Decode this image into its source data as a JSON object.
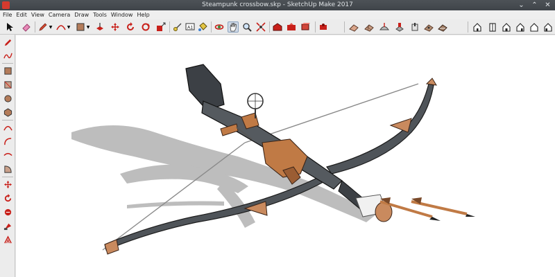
{
  "window": {
    "title": "Steampunk crossbow.skp - SketchUp Make 2017",
    "controls": [
      "⌄",
      "⌃",
      "✕"
    ]
  },
  "menubar": {
    "items": [
      "File",
      "Edit",
      "View",
      "Camera",
      "Draw",
      "Tools",
      "Window",
      "Help"
    ]
  },
  "toolbar": {
    "tools": [
      {
        "name": "select-tool",
        "icon": "arrow-icon"
      },
      {
        "name": "eraser-tool",
        "icon": "eraser-icon"
      },
      {
        "name": "line-tool",
        "icon": "pencil-icon"
      },
      {
        "name": "arc-tool",
        "icon": "arc-icon"
      },
      {
        "name": "shape-tool",
        "icon": "rectangle-icon"
      },
      {
        "name": "push-pull-tool",
        "icon": "push-pull-icon"
      },
      {
        "name": "move-tool",
        "icon": "move-icon"
      },
      {
        "name": "rotate-tool",
        "icon": "rotate-icon"
      },
      {
        "name": "scale-tool",
        "icon": "scale-icon"
      },
      {
        "name": "tape-measure-tool",
        "icon": "tape-measure-icon"
      },
      {
        "name": "text-tool",
        "icon": "text-icon",
        "label": "A1"
      },
      {
        "name": "paint-bucket-tool",
        "icon": "paint-bucket-icon"
      },
      {
        "name": "orbit-tool",
        "icon": "orbit-icon"
      },
      {
        "name": "pan-tool",
        "icon": "hand-icon",
        "active": true
      },
      {
        "name": "zoom-tool",
        "icon": "magnifier-icon"
      },
      {
        "name": "zoom-extents-tool",
        "icon": "zoom-extents-icon"
      },
      {
        "name": "warehouse-tool",
        "icon": "warehouse-icon"
      },
      {
        "name": "share-model-tool",
        "icon": "share-icon"
      },
      {
        "name": "components-tool",
        "icon": "components-icon"
      },
      {
        "name": "extension-tool",
        "icon": "extension-icon"
      },
      {
        "name": "sandbox-contours-tool",
        "icon": "sandbox-icon"
      },
      {
        "name": "sandbox-scratch-tool",
        "icon": "sandbox-grid-icon"
      },
      {
        "name": "sandbox-smoove-tool",
        "icon": "smoove-icon"
      },
      {
        "name": "sandbox-stamp-tool",
        "icon": "stamp-icon"
      },
      {
        "name": "sandbox-drape-tool",
        "icon": "drape-icon"
      },
      {
        "name": "sandbox-add-detail-tool",
        "icon": "add-detail-icon"
      },
      {
        "name": "sandbox-flip-edge-tool",
        "icon": "flip-edge-icon"
      },
      {
        "name": "iso-view",
        "icon": "iso-house-icon"
      },
      {
        "name": "top-view",
        "icon": "top-view-icon"
      },
      {
        "name": "front-view",
        "icon": "front-house-icon"
      },
      {
        "name": "right-view",
        "icon": "right-house-icon"
      },
      {
        "name": "back-view",
        "icon": "back-house-icon"
      },
      {
        "name": "left-view",
        "icon": "left-house-icon"
      }
    ]
  },
  "left_toolbar": {
    "tools": [
      {
        "name": "line-tool",
        "icon": "pencil-icon"
      },
      {
        "name": "freehand-tool",
        "icon": "freehand-icon"
      },
      {
        "name": "rectangle-tool",
        "icon": "rectangle-icon"
      },
      {
        "name": "rotated-rectangle-tool",
        "icon": "rotated-rectangle-icon"
      },
      {
        "name": "circle-tool",
        "icon": "circle-icon"
      },
      {
        "name": "polygon-tool",
        "icon": "polygon-icon"
      },
      {
        "name": "arc-tool",
        "icon": "arc-icon"
      },
      {
        "name": "two-point-arc-tool",
        "icon": "arc-icon"
      },
      {
        "name": "three-point-arc-tool",
        "icon": "arc-icon"
      },
      {
        "name": "pie-tool",
        "icon": "pie-icon"
      },
      {
        "name": "move-tool",
        "icon": "move-icon"
      },
      {
        "name": "rotate-tool",
        "icon": "rotate-icon"
      },
      {
        "name": "scale-tool",
        "icon": "scale-icon"
      },
      {
        "name": "follow-me-tool",
        "icon": "follow-me-icon"
      },
      {
        "name": "offset-tool",
        "icon": "offset-icon"
      }
    ]
  },
  "colors": {
    "accent_red": "#c8201a",
    "wood": "#c07a45",
    "metal_dark": "#555a5f",
    "shadow": "#bcbcbc"
  }
}
